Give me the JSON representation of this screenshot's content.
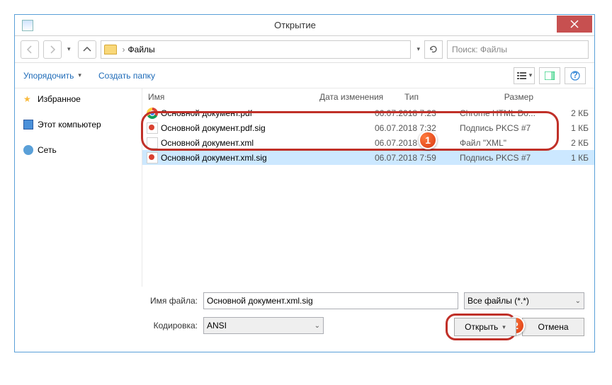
{
  "title": "Открытие",
  "nav": {
    "path_label": "Файлы",
    "search_placeholder": "Поиск: Файлы"
  },
  "toolbar": {
    "organize": "Упорядочить",
    "new_folder": "Создать папку"
  },
  "sidebar": {
    "favorites": "Избранное",
    "this_pc": "Этот компьютер",
    "network": "Сеть"
  },
  "columns": {
    "name": "Имя",
    "date": "Дата изменения",
    "type": "Тип",
    "size": "Размер"
  },
  "files": [
    {
      "name": "Основной документ.pdf",
      "date": "06.07.2018 7:23",
      "type": "Chrome HTML Do...",
      "size": "2 КБ",
      "icon": "chrome"
    },
    {
      "name": "Основной документ.pdf.sig",
      "date": "06.07.2018 7:32",
      "type": "Подпись PKCS #7",
      "size": "1 КБ",
      "icon": "sig"
    },
    {
      "name": "Основной документ.xml",
      "date": "06.07.2018 7:23",
      "type": "Файл \"XML\"",
      "size": "2 КБ",
      "icon": "xml"
    },
    {
      "name": "Основной документ.xml.sig",
      "date": "06.07.2018 7:59",
      "type": "Подпись PKCS #7",
      "size": "1 КБ",
      "icon": "sig"
    }
  ],
  "form": {
    "filename_label": "Имя файла:",
    "filename_value": "Основной документ.xml.sig",
    "encoding_label": "Кодировка:",
    "encoding_value": "ANSI",
    "filter_value": "Все файлы (*.*)",
    "open": "Открыть",
    "cancel": "Отмена"
  },
  "callouts": {
    "one": "1",
    "two": "2"
  }
}
